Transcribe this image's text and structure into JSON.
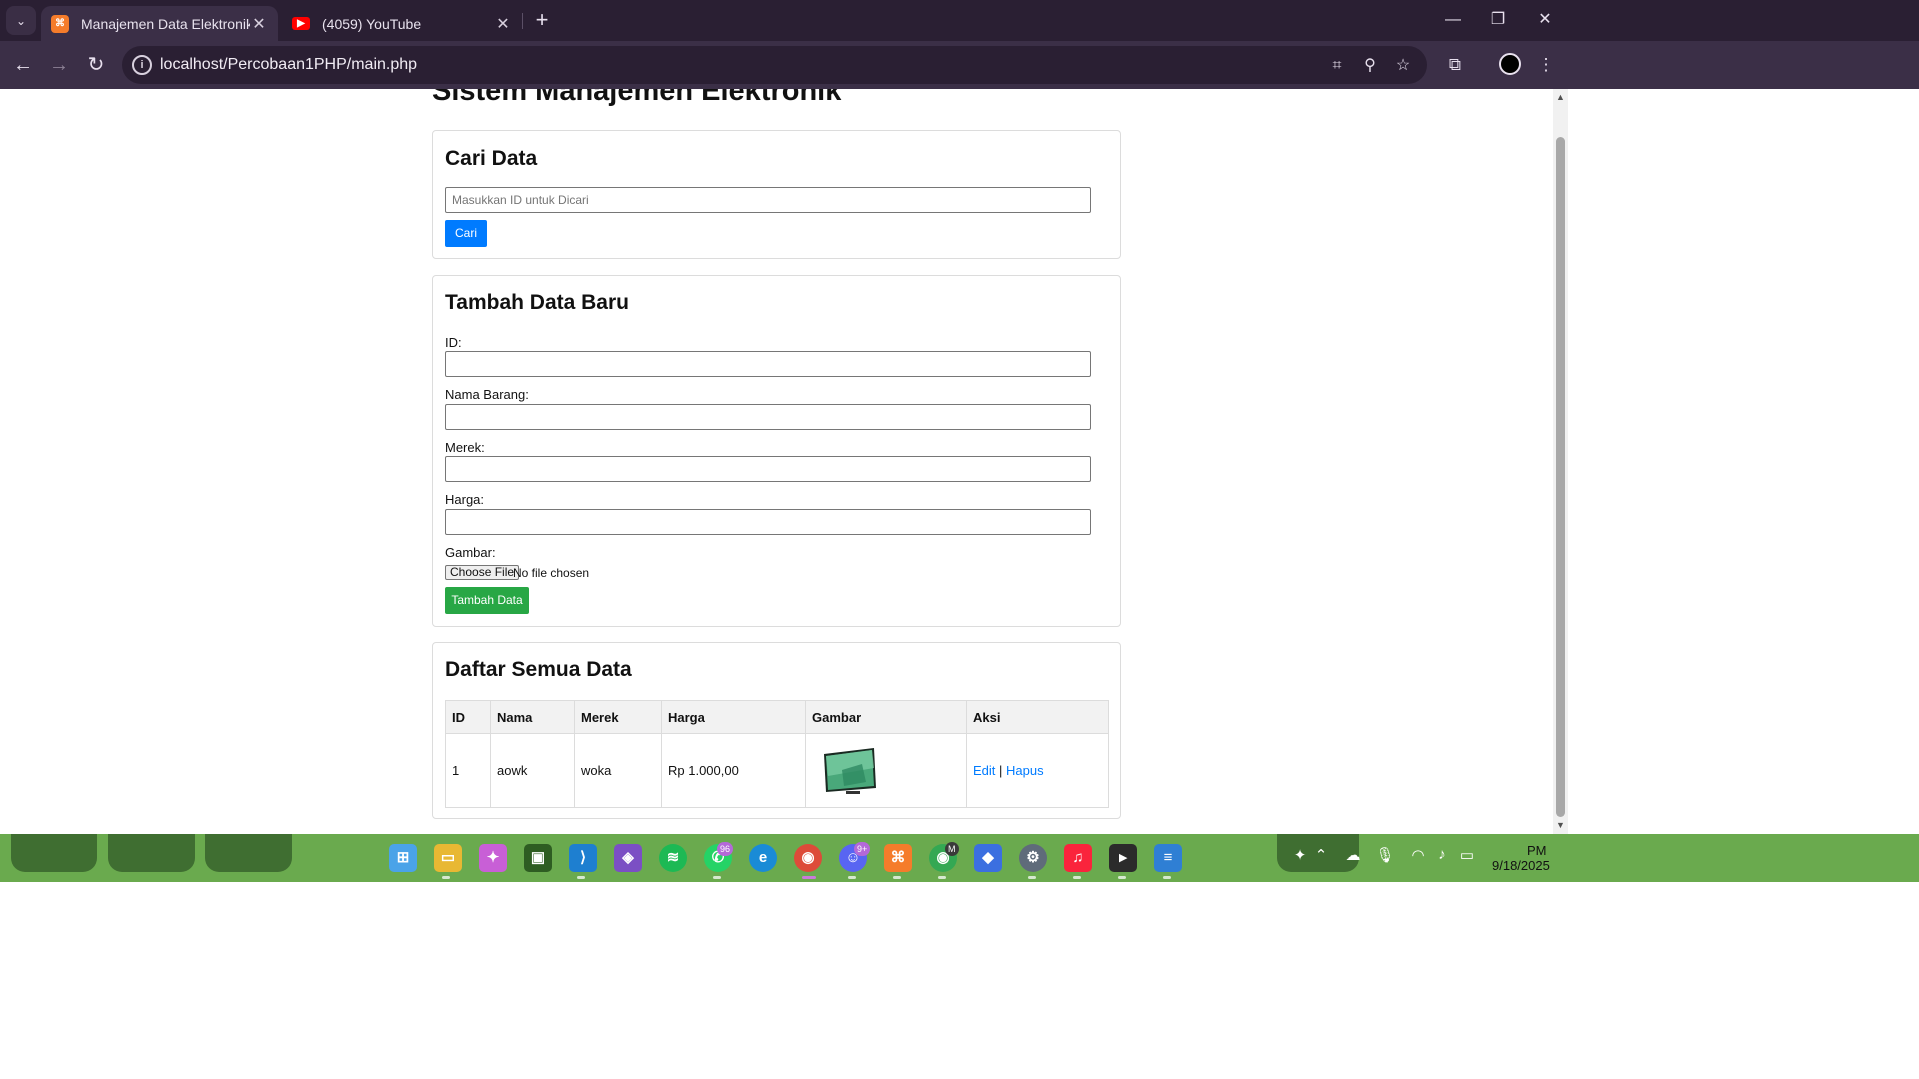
{
  "browser": {
    "tabs": [
      {
        "title": "Manajemen Data Elektronik",
        "favicon": "xampp-icon"
      },
      {
        "title": "(4059) YouTube",
        "favicon": "youtube-icon"
      }
    ],
    "url": "localhost/Percobaan1PHP/main.php"
  },
  "page": {
    "title": "Sistem Manajemen Elektronik",
    "search": {
      "heading": "Cari Data",
      "placeholder": "Masukkan ID untuk Dicari",
      "button": "Cari"
    },
    "add": {
      "heading": "Tambah Data Baru",
      "fields": {
        "id": "ID:",
        "nama": "Nama Barang:",
        "merek": "Merek:",
        "harga": "Harga:",
        "gambar": "Gambar:"
      },
      "file_button": "Choose File",
      "file_status": "No file chosen",
      "submit": "Tambah Data"
    },
    "list": {
      "heading": "Daftar Semua Data",
      "columns": [
        "ID",
        "Nama",
        "Merek",
        "Harga",
        "Gambar",
        "Aksi"
      ],
      "rows": [
        {
          "id": "1",
          "nama": "aowk",
          "merek": "woka",
          "harga": "Rp 1.000,00",
          "gambar": "tv-image",
          "edit": "Edit",
          "sep": "|",
          "hapus": "Hapus"
        }
      ]
    }
  },
  "taskbar": {
    "badges": {
      "whatsapp": "96",
      "discord": "9+",
      "chrome_profile": "M"
    },
    "date": "9/18/2025",
    "time": "PM"
  },
  "colors": {
    "primary_button": "#007bff",
    "success_button": "#28a745",
    "link": "#007bff",
    "browser_frame": "#2a1f33",
    "taskbar": "#6aaa4e"
  }
}
